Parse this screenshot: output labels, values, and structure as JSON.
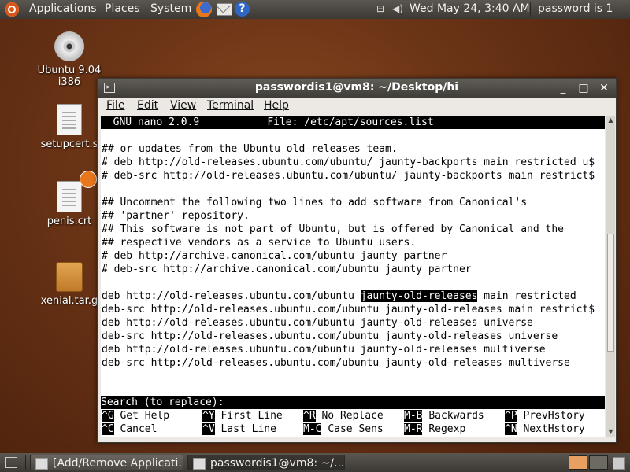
{
  "top_panel": {
    "menus": [
      "Applications",
      "Places",
      "System"
    ],
    "datetime": "Wed May 24,  3:40 AM",
    "user": "password is 1"
  },
  "desktop_icons": [
    {
      "label": "Ubuntu 9.04 i386",
      "icon": "cd-icon"
    },
    {
      "label": "setupcert.s",
      "icon": "script-icon"
    },
    {
      "label": "penis.crt",
      "icon": "certificate-icon"
    },
    {
      "label": "xenial.tar.g",
      "icon": "archive-icon"
    }
  ],
  "terminal": {
    "title": "passwordis1@vm8: ~/Desktop/hi",
    "menu": [
      "File",
      "Edit",
      "View",
      "Terminal",
      "Help"
    ],
    "nano_header": "  GNU nano 2.0.9           File: /etc/apt/sources.list                    ",
    "lines": [
      "",
      "## or updates from the Ubuntu old-releases team.",
      "# deb http://old-releases.ubuntu.com/ubuntu/ jaunty-backports main restricted u$",
      "# deb-src http://old-releases.ubuntu.com/ubuntu/ jaunty-backports main restrict$",
      "",
      "## Uncomment the following two lines to add software from Canonical's",
      "## 'partner' repository.",
      "## This software is not part of Ubuntu, but is offered by Canonical and the",
      "## respective vendors as a service to Ubuntu users.",
      "# deb http://archive.canonical.com/ubuntu jaunty partner",
      "# deb-src http://archive.canonical.com/ubuntu jaunty partner",
      "",
      "deb http://old-releases.ubuntu.com/ubuntu ",
      "deb-src http://old-releases.ubuntu.com/ubuntu jaunty-old-releases main restrict$",
      "deb http://old-releases.ubuntu.com/ubuntu jaunty-old-releases universe",
      "deb-src http://old-releases.ubuntu.com/ubuntu jaunty-old-releases universe",
      "deb http://old-releases.ubuntu.com/ubuntu jaunty-old-releases multiverse",
      "deb-src http://old-releases.ubuntu.com/ubuntu jaunty-old-releases multiverse"
    ],
    "highlight_word": "jaunty-old-releases",
    "highlight_rest": " main restricted",
    "search_prompt": "Search (to replace): ",
    "shortcuts_row1": [
      {
        "key": "^G",
        "label": "Get Help"
      },
      {
        "key": "^Y",
        "label": "First Line"
      },
      {
        "key": "^R",
        "label": "No Replace"
      },
      {
        "key": "M-B",
        "label": "Backwards"
      },
      {
        "key": "^P",
        "label": "PrevHstory"
      }
    ],
    "shortcuts_row2": [
      {
        "key": "^C",
        "label": "Cancel"
      },
      {
        "key": "^V",
        "label": "Last Line"
      },
      {
        "key": "M-C",
        "label": "Case Sens"
      },
      {
        "key": "M-R",
        "label": "Regexp"
      },
      {
        "key": "^N",
        "label": "NextHstory"
      }
    ]
  },
  "bottom_panel": {
    "tasks": [
      {
        "label": "[Add/Remove Applicati...",
        "active": false
      },
      {
        "label": "passwordis1@vm8: ~/...",
        "active": true
      }
    ]
  },
  "colors": {
    "desktop": "#6b3416",
    "panel": "#48453f",
    "terminal_bg": "#ffffff",
    "terminal_fg": "#000000"
  }
}
